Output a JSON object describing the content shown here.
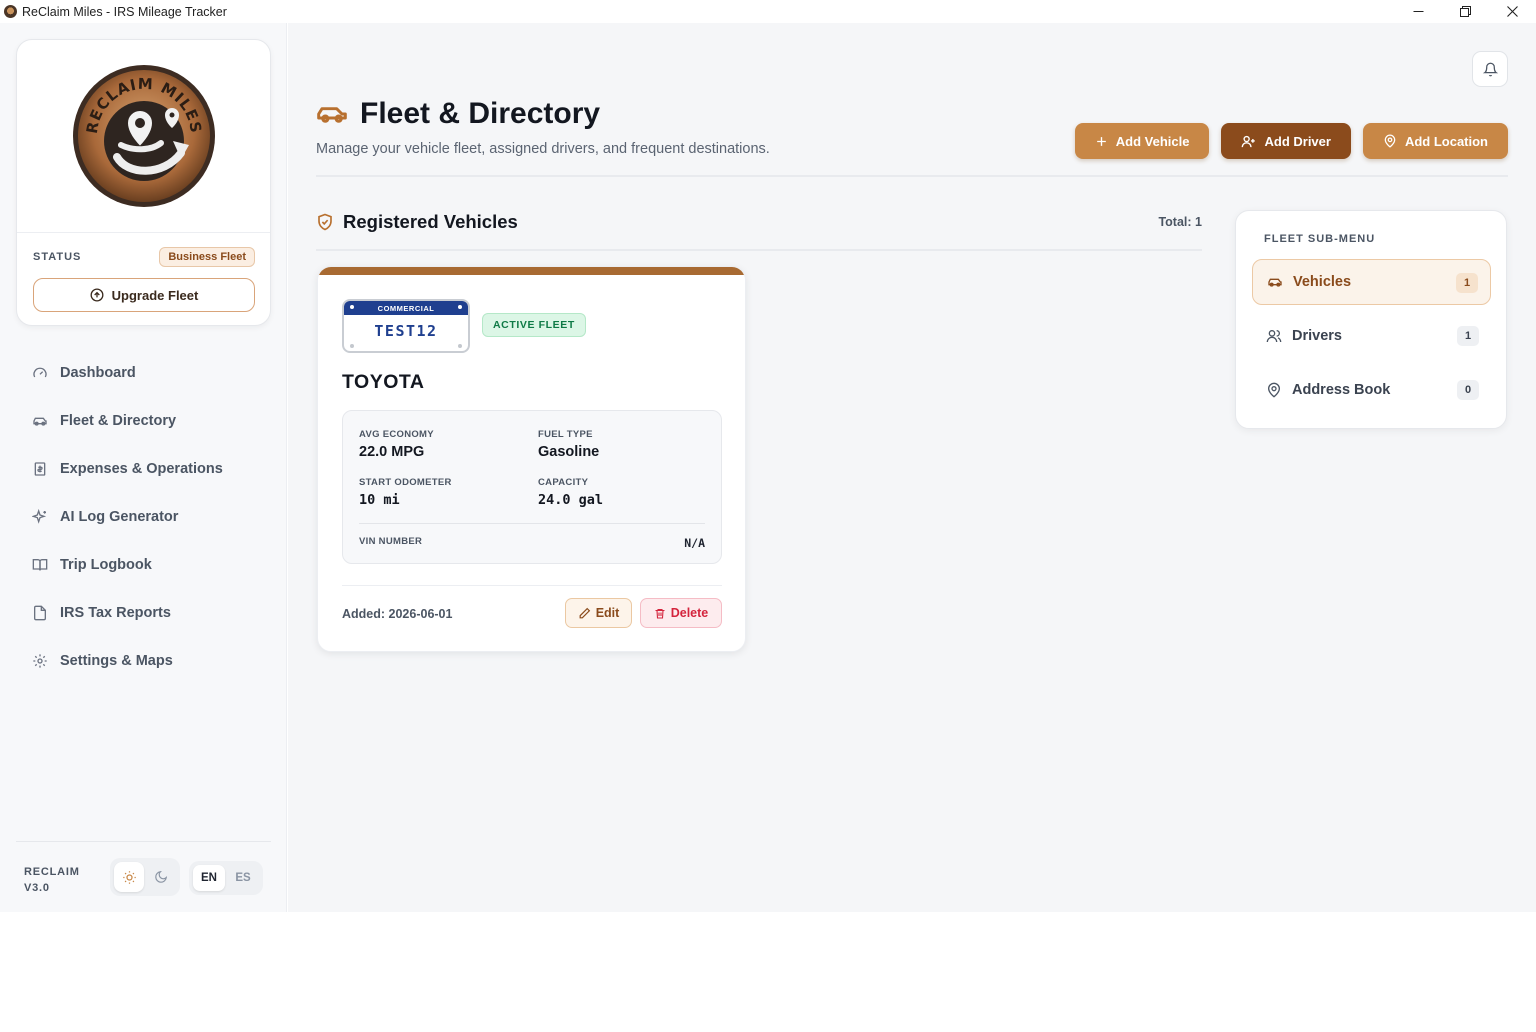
{
  "window": {
    "title": "ReClaim Miles - IRS Mileage Tracker"
  },
  "sidebar": {
    "logo_text": "RECLAIM MILES",
    "status_label": "STATUS",
    "status_badge": "Business Fleet",
    "upgrade_label": "Upgrade Fleet",
    "nav": [
      {
        "label": "Dashboard",
        "icon": "gauge-icon"
      },
      {
        "label": "Fleet & Directory",
        "icon": "car-icon"
      },
      {
        "label": "Expenses & Operations",
        "icon": "receipt-icon"
      },
      {
        "label": "AI Log Generator",
        "icon": "sparkles-icon"
      },
      {
        "label": "Trip Logbook",
        "icon": "book-icon"
      },
      {
        "label": "IRS Tax Reports",
        "icon": "file-icon"
      },
      {
        "label": "Settings & Maps",
        "icon": "gear-icon"
      }
    ],
    "version_line1": "RECLAIM",
    "version_line2": "V3.0",
    "lang_en": "EN",
    "lang_es": "ES"
  },
  "header": {
    "title": "Fleet & Directory",
    "subtitle": "Manage your vehicle fleet, assigned drivers, and frequent destinations.",
    "add_vehicle": "Add Vehicle",
    "add_driver": "Add Driver",
    "add_location": "Add Location"
  },
  "section": {
    "title": "Registered Vehicles",
    "total": "Total: 1"
  },
  "vehicle": {
    "plate_band": "COMMERCIAL",
    "plate_number": "TEST12",
    "badge": "ACTIVE FLEET",
    "make": "TOYOTA",
    "avg_economy_label": "AVG ECONOMY",
    "avg_economy": "22.0 MPG",
    "fuel_type_label": "FUEL TYPE",
    "fuel_type": "Gasoline",
    "start_odometer_label": "START ODOMETER",
    "start_odometer": "10 mi",
    "capacity_label": "CAPACITY",
    "capacity": "24.0 gal",
    "vin_label": "VIN NUMBER",
    "vin": "N/A",
    "added": "Added: 2026-06-01",
    "edit": "Edit",
    "delete": "Delete"
  },
  "submenu": {
    "title": "FLEET SUB-MENU",
    "items": [
      {
        "label": "Vehicles",
        "count": "1"
      },
      {
        "label": "Drivers",
        "count": "1"
      },
      {
        "label": "Address Book",
        "count": "0"
      }
    ]
  },
  "colors": {
    "accent": "#c88746",
    "accent_dark": "#8b4b1c",
    "success": "#0f7a46",
    "danger": "#d4243d",
    "plate_blue": "#1f3f8f"
  }
}
